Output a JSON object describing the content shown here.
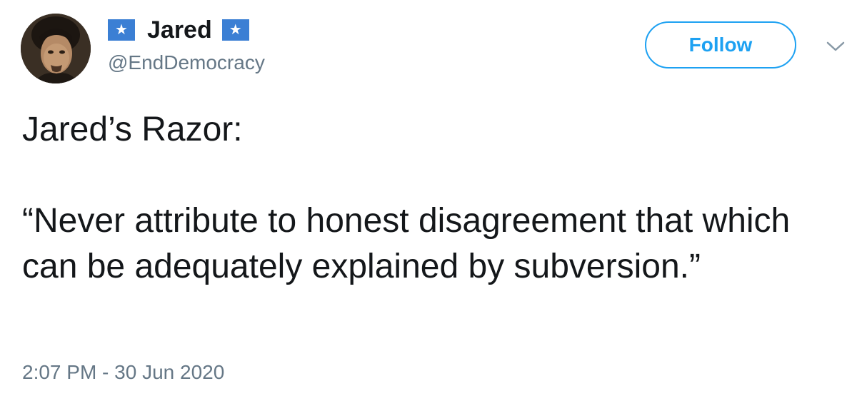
{
  "user": {
    "display_name": "Jared",
    "handle": "@EndDemocracy",
    "badge_glyph": "★",
    "badge_color": "#3b7fd4"
  },
  "follow_button": {
    "label": "Follow",
    "color": "#1da1f2"
  },
  "menu": {
    "icon": "chevron-down-icon"
  },
  "tweet": {
    "line1": "Jared’s Razor:",
    "line2": "“Never attribute to honest disagreement that which can be adequately explained by subversion.”"
  },
  "timestamp": "2:07 PM - 30 Jun 2020",
  "colors": {
    "text": "#14171a",
    "secondary": "#657786",
    "accent": "#1da1f2"
  }
}
